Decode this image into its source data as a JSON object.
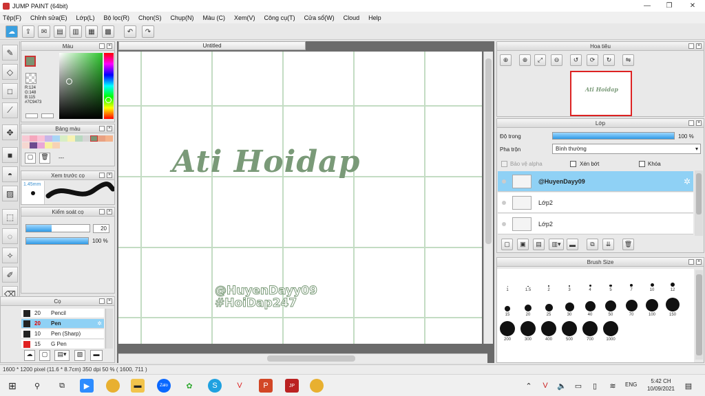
{
  "window": {
    "title": "JUMP PAINT (64bit)",
    "controls": [
      "—",
      "❐",
      "✕"
    ]
  },
  "menu": [
    "Tệp(F)",
    "Chỉnh sửa(E)",
    "Lớp(L)",
    "Bộ lọc(R)",
    "Chọn(S)",
    "Chụp(N)",
    "Màu (C)",
    "Xem(V)",
    "Công cụ(T)",
    "Cửa sổ(W)",
    "Cloud",
    "Help"
  ],
  "color_panel": {
    "title": "Màu",
    "r": "R:124",
    "g": "G:148",
    "b": "B:115",
    "hex": "#7C9473",
    "color": "#7C9473"
  },
  "palette_panel": {
    "title": "Bảng màu",
    "more": "---"
  },
  "preview_panel": {
    "title": "Xem trước cọ",
    "size": "1.45mm"
  },
  "brush_control": {
    "title": "Kiểm soát cọ",
    "size_value": "20",
    "opacity_value": "100 %"
  },
  "brush_panel": {
    "title": "Cọ",
    "rows": [
      {
        "size": "20",
        "name": "Pencil",
        "color": "#222222"
      },
      {
        "size": "20",
        "name": "Pen",
        "color": "#222222"
      },
      {
        "size": "10",
        "name": "Pen (Sharp)",
        "color": "#222222"
      },
      {
        "size": "15",
        "name": "G Pen",
        "color": "#e02020"
      }
    ]
  },
  "canvas": {
    "tab": "Untitled",
    "text_main": "Ati Hoidap",
    "text_watermark1": "@HuyenDayy09",
    "text_watermark2": "#HoiDap247"
  },
  "navigator": {
    "title": "Hoa tiêu",
    "thumb_text": "Ati Hoidap"
  },
  "layers": {
    "title": "Lớp",
    "opacity_label": "Độ trong",
    "opacity_value": "100 %",
    "blend_label": "Pha trộn",
    "blend_value": "Bình thường",
    "protect_alpha": "Bảo vệ alpha",
    "clip": "Xén bớt",
    "lock": "Khóa",
    "rows": [
      "@HuyenDayy09",
      "Lớp2",
      "Lớp2"
    ]
  },
  "brush_size": {
    "title": "Brush Size",
    "sizes": [
      "1",
      "1.5",
      "2",
      "3",
      "4",
      "5",
      "7",
      "10",
      "12",
      "15",
      "20",
      "25",
      "30",
      "40",
      "50",
      "70",
      "100",
      "150",
      "200",
      "300",
      "400",
      "500",
      "700",
      "1000"
    ]
  },
  "status": {
    "text": "1600 * 1200 pixel   (11.6 * 8.7cm)  350 dpi   50 %   ( 1600, 711 )"
  },
  "taskbar": {
    "time": "5:42 CH",
    "date": "10/09/2021",
    "lang": "ENG"
  }
}
